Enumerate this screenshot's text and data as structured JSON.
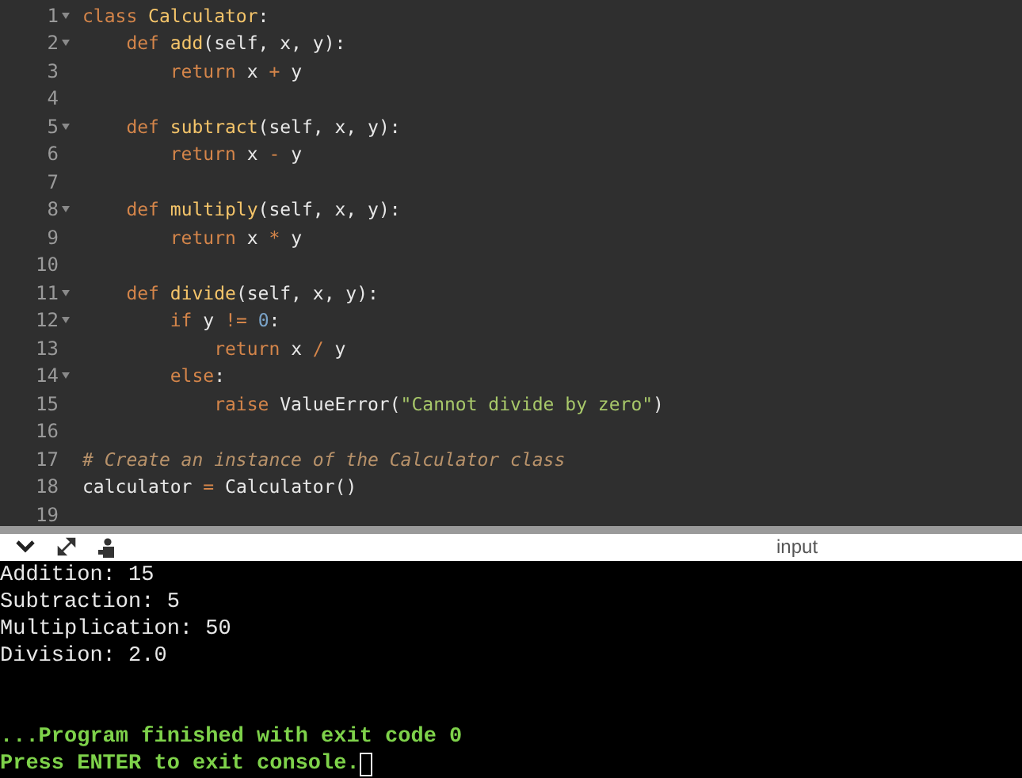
{
  "editor": {
    "lines": [
      {
        "number": "1",
        "foldable": true,
        "tokens": [
          {
            "kind": "keyword",
            "text": "class "
          },
          {
            "kind": "name",
            "text": "Calculator"
          },
          {
            "kind": "plain",
            "text": ":"
          }
        ]
      },
      {
        "number": "2",
        "foldable": true,
        "tokens": [
          {
            "kind": "keyword",
            "text": "    def "
          },
          {
            "kind": "name",
            "text": "add"
          },
          {
            "kind": "plain",
            "text": "(self, x, y):"
          }
        ]
      },
      {
        "number": "3",
        "foldable": false,
        "tokens": [
          {
            "kind": "keyword",
            "text": "        return "
          },
          {
            "kind": "plain",
            "text": "x "
          },
          {
            "kind": "op",
            "text": "+ "
          },
          {
            "kind": "plain",
            "text": "y"
          }
        ]
      },
      {
        "number": "4",
        "foldable": false
      },
      {
        "number": "5",
        "foldable": true,
        "tokens": [
          {
            "kind": "keyword",
            "text": "    def "
          },
          {
            "kind": "name",
            "text": "subtract"
          },
          {
            "kind": "plain",
            "text": "(self, x, y):"
          }
        ]
      },
      {
        "number": "6",
        "foldable": false,
        "tokens": [
          {
            "kind": "keyword",
            "text": "        return "
          },
          {
            "kind": "plain",
            "text": "x "
          },
          {
            "kind": "op",
            "text": "- "
          },
          {
            "kind": "plain",
            "text": "y"
          }
        ]
      },
      {
        "number": "7",
        "foldable": false
      },
      {
        "number": "8",
        "foldable": true,
        "tokens": [
          {
            "kind": "keyword",
            "text": "    def "
          },
          {
            "kind": "name",
            "text": "multiply"
          },
          {
            "kind": "plain",
            "text": "(self, x, y):"
          }
        ]
      },
      {
        "number": "9",
        "foldable": false,
        "tokens": [
          {
            "kind": "keyword",
            "text": "        return "
          },
          {
            "kind": "plain",
            "text": "x "
          },
          {
            "kind": "op",
            "text": "* "
          },
          {
            "kind": "plain",
            "text": "y"
          }
        ]
      },
      {
        "number": "10",
        "foldable": false
      },
      {
        "number": "11",
        "foldable": true,
        "tokens": [
          {
            "kind": "keyword",
            "text": "    def "
          },
          {
            "kind": "name",
            "text": "divide"
          },
          {
            "kind": "plain",
            "text": "(self, x, y):"
          }
        ]
      },
      {
        "number": "12",
        "foldable": true,
        "tokens": [
          {
            "kind": "keyword",
            "text": "        if "
          },
          {
            "kind": "plain",
            "text": "y "
          },
          {
            "kind": "op",
            "text": "!= "
          },
          {
            "kind": "number",
            "text": "0"
          },
          {
            "kind": "plain",
            "text": ":"
          }
        ]
      },
      {
        "number": "13",
        "foldable": false,
        "tokens": [
          {
            "kind": "keyword",
            "text": "            return "
          },
          {
            "kind": "plain",
            "text": "x "
          },
          {
            "kind": "op",
            "text": "/ "
          },
          {
            "kind": "plain",
            "text": "y"
          }
        ]
      },
      {
        "number": "14",
        "foldable": true,
        "tokens": [
          {
            "kind": "keyword",
            "text": "        else"
          },
          {
            "kind": "plain",
            "text": ":"
          }
        ]
      },
      {
        "number": "15",
        "foldable": false,
        "tokens": [
          {
            "kind": "keyword",
            "text": "            raise "
          },
          {
            "kind": "plain",
            "text": "ValueError("
          },
          {
            "kind": "string",
            "text": "\"Cannot divide by zero\""
          },
          {
            "kind": "plain",
            "text": ")"
          }
        ]
      },
      {
        "number": "16",
        "foldable": false
      },
      {
        "number": "17",
        "foldable": false,
        "tokens": [
          {
            "kind": "comment",
            "text": "# Create an instance of the Calculator class"
          }
        ]
      },
      {
        "number": "18",
        "foldable": false,
        "tokens": [
          {
            "kind": "plain",
            "text": "calculator "
          },
          {
            "kind": "op",
            "text": "= "
          },
          {
            "kind": "plain",
            "text": "Calculator()"
          }
        ]
      },
      {
        "number": "19",
        "foldable": false
      }
    ]
  },
  "console": {
    "tab_label": "input",
    "lines": [
      {
        "kind": "output",
        "text": "Addition: 15"
      },
      {
        "kind": "output",
        "text": "Subtraction: 5"
      },
      {
        "kind": "output",
        "text": "Multiplication: 50"
      },
      {
        "kind": "output",
        "text": "Division: 2.0"
      },
      {
        "kind": "blank"
      },
      {
        "kind": "blank"
      },
      {
        "kind": "status",
        "text": "...Program finished with exit code 0"
      },
      {
        "kind": "prompt",
        "text": "Press ENTER to exit console."
      }
    ]
  }
}
